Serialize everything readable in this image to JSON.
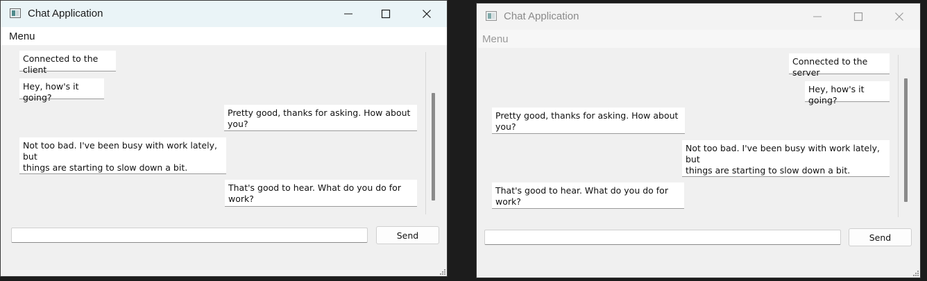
{
  "windows": {
    "left": {
      "title": "Chat Application",
      "menu": "Menu",
      "messages": [
        {
          "text": "Connected to the client",
          "side": "left"
        },
        {
          "text": "Hey, how's it going?",
          "side": "left"
        },
        {
          "text": "Pretty good, thanks for asking. How about you?",
          "side": "right"
        },
        {
          "text": "Not too bad. I've been busy with work lately, but\nthings are starting to slow down a bit.",
          "side": "left"
        },
        {
          "text": "That's good to hear. What do you do for work?",
          "side": "right"
        }
      ],
      "input_value": "",
      "send_label": "Send"
    },
    "right": {
      "title": "Chat Application",
      "menu": "Menu",
      "messages": [
        {
          "text": "Connected to the server",
          "side": "right"
        },
        {
          "text": "Hey, how's it going?",
          "side": "right"
        },
        {
          "text": "Pretty good, thanks for asking. How about you?",
          "side": "left"
        },
        {
          "text": "Not too bad. I've been busy with work lately, but\nthings are starting to slow down a bit.",
          "side": "right"
        },
        {
          "text": "That's good to hear. What do you do for work?",
          "side": "left"
        }
      ],
      "input_value": "",
      "send_label": "Send"
    }
  },
  "icons": {
    "app": "app-window-icon",
    "minimize": "minimize-icon",
    "maximize": "maximize-icon",
    "close": "close-icon",
    "grip": "resize-grip-icon"
  },
  "colors": {
    "active_titlebar": "#eaf4f7",
    "inactive_titlebar": "#f3f3f3",
    "window_bg": "#f0f0f0",
    "bubble_bg": "#ffffff"
  }
}
